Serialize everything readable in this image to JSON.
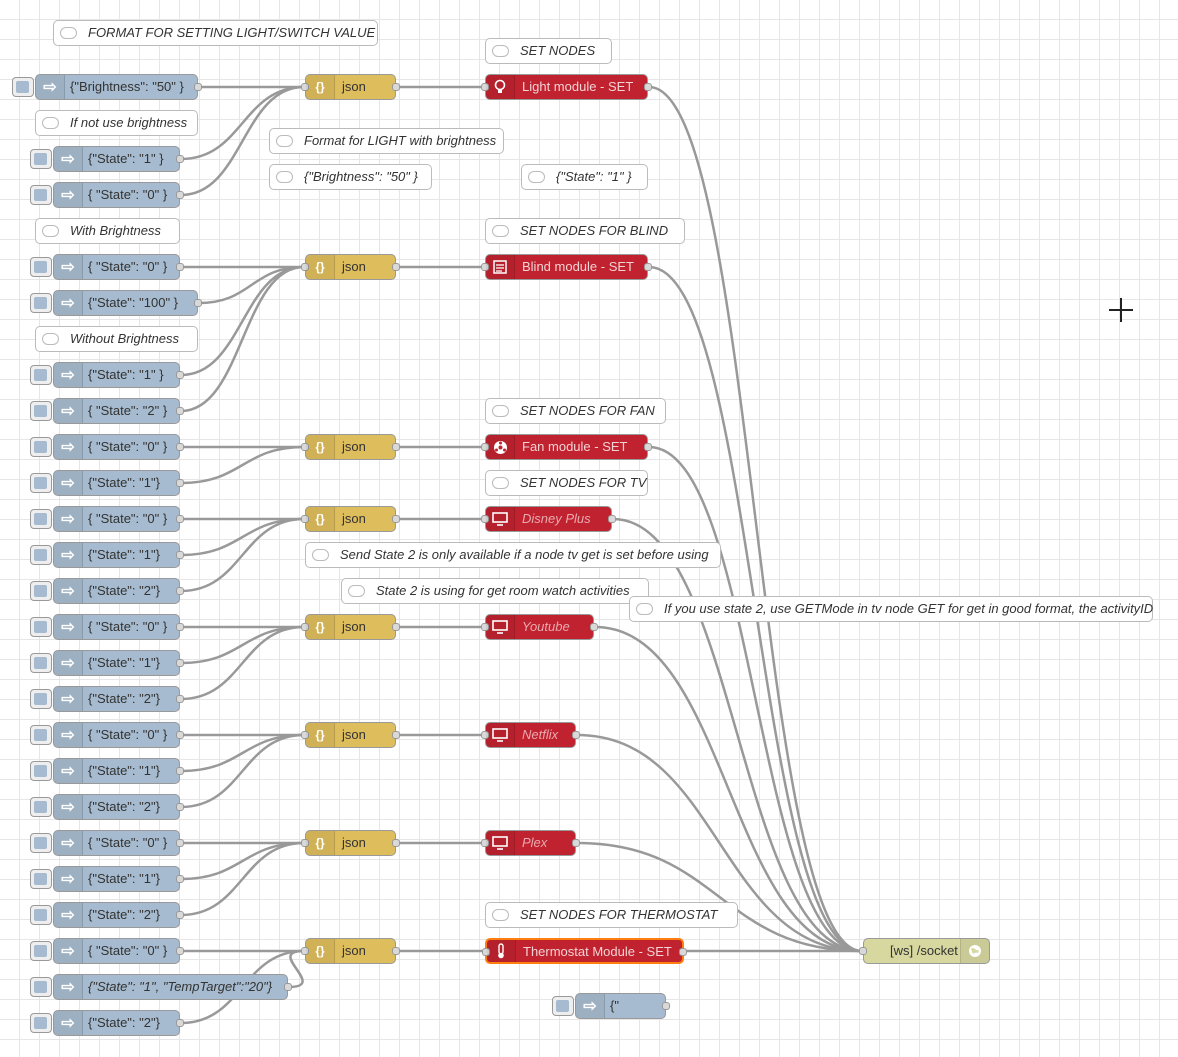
{
  "comments": [
    {
      "id": "c_format",
      "text": "FORMAT FOR SETTING LIGHT/SWITCH VALUE"
    },
    {
      "id": "c_setnodes",
      "text": "SET NODES"
    },
    {
      "id": "c_ifnot",
      "text": "If not use brightness"
    },
    {
      "id": "c_fmtlight",
      "text": "Format for LIGHT with brightness"
    },
    {
      "id": "c_brightness",
      "text": "{\"Brightness\": \"50\" }"
    },
    {
      "id": "c_state1",
      "text": "{\"State\": \"1\" }"
    },
    {
      "id": "c_withbright",
      "text": "With Brightness"
    },
    {
      "id": "c_blind",
      "text": "SET NODES FOR BLIND"
    },
    {
      "id": "c_withoutbright",
      "text": "Without Brightness"
    },
    {
      "id": "c_fan",
      "text": "SET NODES FOR FAN"
    },
    {
      "id": "c_tv",
      "text": "SET NODES FOR TV"
    },
    {
      "id": "c_state2tv",
      "text": "Send State 2 is only available if a node tv get is set before using"
    },
    {
      "id": "c_state2room",
      "text": "State 2 is using for get room watch activities"
    },
    {
      "id": "c_getmode",
      "text": "If you use state 2, use GETMode in tv node GET for get in good format, the activityID"
    },
    {
      "id": "c_thermo",
      "text": "SET NODES FOR THERMOSTAT"
    }
  ],
  "injects": [
    {
      "id": "i_b50",
      "label": "{\"Brightness\": \"50\" }"
    },
    {
      "id": "i_l1",
      "label": "{\"State\": \"1\" }"
    },
    {
      "id": "i_l0",
      "label": "{ \"State\": \"0\" }"
    },
    {
      "id": "i_bl0",
      "label": "{ \"State\": \"0\" }"
    },
    {
      "id": "i_bl100",
      "label": "{\"State\": \"100\" }"
    },
    {
      "id": "i_bl1",
      "label": "{\"State\": \"1\" }"
    },
    {
      "id": "i_bl2",
      "label": "{ \"State\": \"2\" }"
    },
    {
      "id": "i_f0",
      "label": "{ \"State\": \"0\" }"
    },
    {
      "id": "i_f1",
      "label": "{\"State\": \"1\"}"
    },
    {
      "id": "i_d0",
      "label": "{ \"State\": \"0\" }"
    },
    {
      "id": "i_d1",
      "label": "{\"State\": \"1\"}"
    },
    {
      "id": "i_d2",
      "label": "{\"State\": \"2\"}"
    },
    {
      "id": "i_y0",
      "label": "{ \"State\": \"0\" }"
    },
    {
      "id": "i_y1",
      "label": "{\"State\": \"1\"}"
    },
    {
      "id": "i_y2",
      "label": "{\"State\": \"2\"}"
    },
    {
      "id": "i_n0",
      "label": "{ \"State\": \"0\" }"
    },
    {
      "id": "i_n1",
      "label": "{\"State\": \"1\"}"
    },
    {
      "id": "i_n2",
      "label": "{\"State\": \"2\"}"
    },
    {
      "id": "i_p0",
      "label": "{ \"State\": \"0\" }"
    },
    {
      "id": "i_p1",
      "label": "{\"State\": \"1\"}"
    },
    {
      "id": "i_p2",
      "label": "{\"State\": \"2\"}"
    },
    {
      "id": "i_t0",
      "label": "{ \"State\": \"0\" }"
    },
    {
      "id": "i_t1",
      "label": "{\"State\": \"1\", \"TempTarget\":\"20\"}"
    },
    {
      "id": "i_t2",
      "label": "{\"State\": \"2\"}"
    },
    {
      "id": "i_misc",
      "label": "{\""
    }
  ],
  "json_label": "json",
  "modules": [
    {
      "id": "m_light",
      "label": "Light module - SET",
      "icon": "bulb-icon",
      "italic": false
    },
    {
      "id": "m_blind",
      "label": "Blind module - SET",
      "icon": "blind-icon",
      "italic": false
    },
    {
      "id": "m_fan",
      "label": "Fan module - SET",
      "icon": "fan-icon",
      "italic": false
    },
    {
      "id": "m_disney",
      "label": "Disney Plus",
      "icon": "tv-icon",
      "italic": true
    },
    {
      "id": "m_youtube",
      "label": "Youtube",
      "icon": "tv-icon",
      "italic": true
    },
    {
      "id": "m_netflix",
      "label": "Netflix",
      "icon": "tv-icon",
      "italic": true
    },
    {
      "id": "m_plex",
      "label": "Plex",
      "icon": "tv-icon",
      "italic": true
    },
    {
      "id": "m_thermo",
      "label": "Thermostat Module - SET",
      "icon": "thermometer-icon",
      "italic": false
    }
  ],
  "websocket": {
    "label": "[ws] /socket",
    "icon": "globe-icon"
  },
  "colors": {
    "inject": "#a6bbcf",
    "json": "#debd5c",
    "module": "#c0222f",
    "websocket": "#d7d7a0",
    "wire": "#999999",
    "selected_border": "#ff7f0e"
  }
}
